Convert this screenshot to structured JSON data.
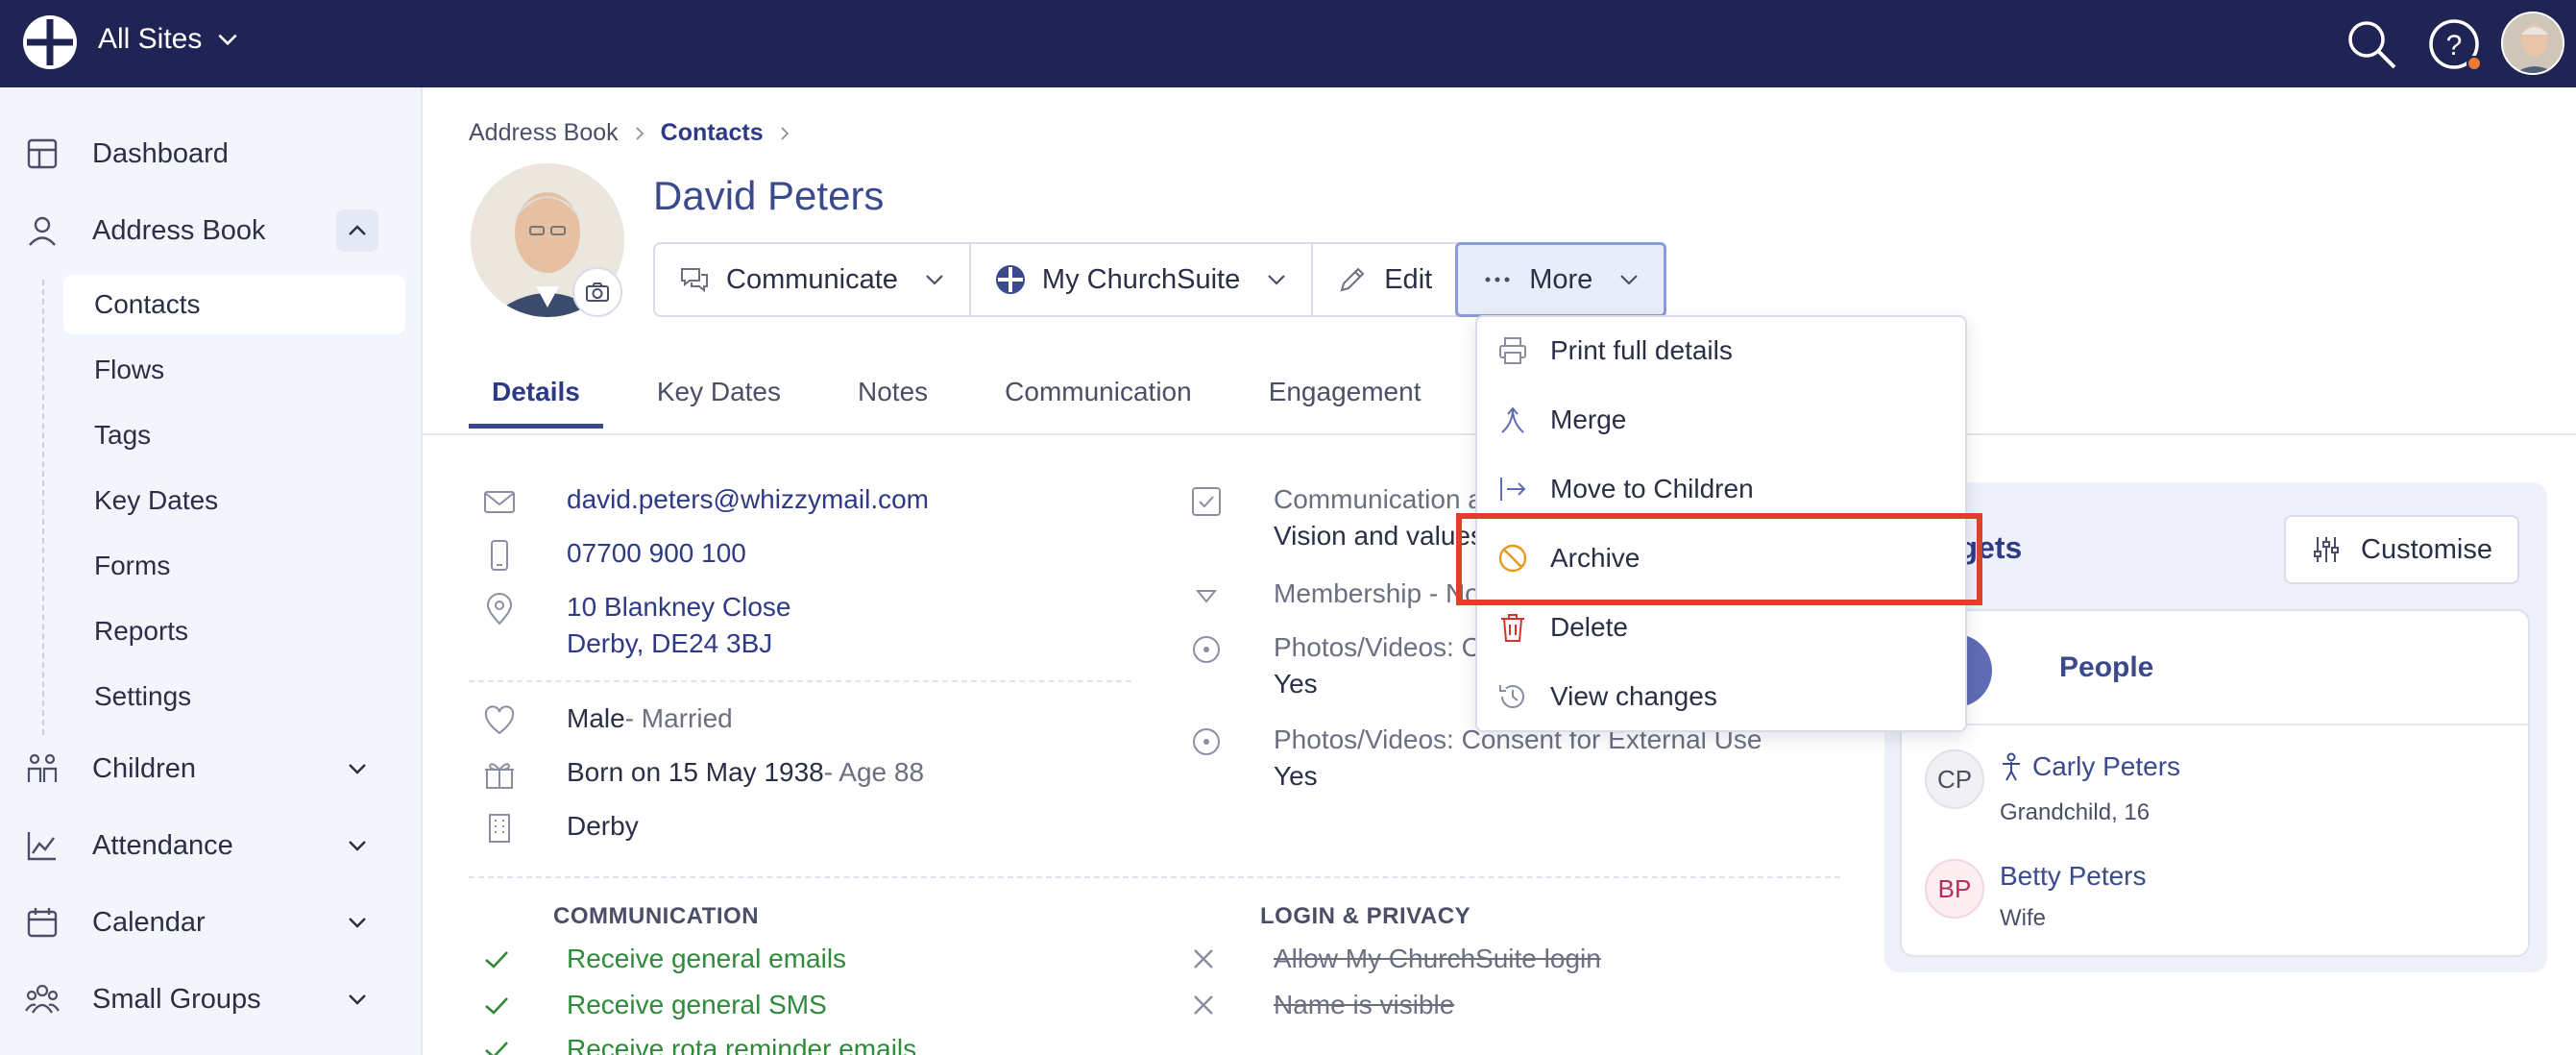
{
  "topbar": {
    "site_label": "All Sites"
  },
  "sidebar": {
    "dashboard": "Dashboard",
    "address_book": "Address Book",
    "sub_items": [
      "Contacts",
      "Flows",
      "Tags",
      "Key Dates",
      "Forms",
      "Reports",
      "Settings"
    ],
    "children": "Children",
    "attendance": "Attendance",
    "calendar": "Calendar",
    "small_groups": "Small Groups"
  },
  "breadcrumb": {
    "root": "Address Book",
    "current": "Contacts"
  },
  "person": {
    "name": "David Peters"
  },
  "actions": {
    "communicate": "Communicate",
    "my_churchsuite": "My ChurchSuite",
    "edit": "Edit",
    "more": "More"
  },
  "tabs": [
    "Details",
    "Key Dates",
    "Notes",
    "Communication",
    "Engagement"
  ],
  "details": {
    "email": "david.peters@whizzymail.com",
    "phone": "07700 900 100",
    "address_line1": "10 Blankney Close",
    "address_line2": "Derby, DE24 3BJ",
    "gender": "Male",
    "marital": " - Married",
    "born": "Born on 15 May 1938",
    "age": " - Age 88",
    "site": "Derby"
  },
  "right_fields": {
    "comm_label": "Communication a",
    "comm_value": "Vision and values",
    "membership": "Membership - No",
    "photos_internal_label": "Photos/Videos: Co",
    "photos_internal_value": "Yes",
    "photos_external_label": "Photos/Videos: Consent for External Use",
    "photos_external_value": "Yes"
  },
  "communication": {
    "heading": "COMMUNICATION",
    "items": [
      "Receive general emails",
      "Receive general SMS",
      "Receive rota reminder emails"
    ]
  },
  "login_privacy": {
    "heading": "LOGIN & PRIVACY",
    "items": [
      "Allow My ChurchSuite login",
      "Name is visible"
    ]
  },
  "widgets": {
    "title_visible": "dgets",
    "customise": "Customise",
    "people_title": "People",
    "people": [
      {
        "initials": "CP",
        "name": "Carly Peters",
        "relation": "Grandchild, 16"
      },
      {
        "initials": "BP",
        "name": "Betty Peters",
        "relation": "Wife"
      }
    ]
  },
  "more_menu": {
    "items": [
      "Print full details",
      "Merge",
      "Move to Children",
      "Archive",
      "Delete",
      "View changes"
    ],
    "highlighted": "Archive"
  },
  "colors": {
    "topbar": "#1f2454",
    "accent": "#2f3a86",
    "highlight": "#e0402a",
    "success": "#2e8b3a",
    "danger": "#d6322c",
    "warning": "#e59a1c"
  }
}
